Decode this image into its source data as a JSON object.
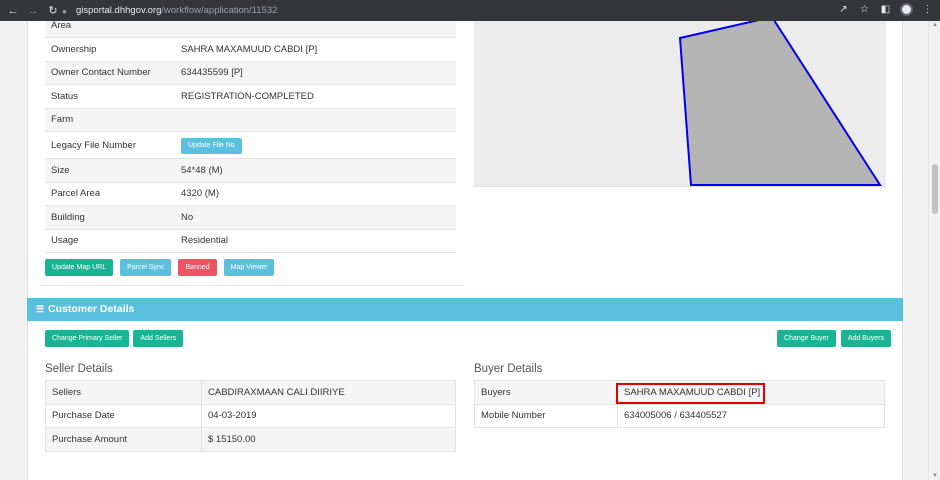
{
  "browser": {
    "url_host": "gisportal.dhhgov.org",
    "url_path": "/workflow/application/11532"
  },
  "parcel": {
    "partial_row_label": "Area",
    "rows": [
      {
        "label": "Ownership",
        "value": "SAHRA MAXAMUUD CABDI [P]"
      },
      {
        "label": "Owner Contact Number",
        "value": "634435599 [P]"
      },
      {
        "label": "Status",
        "value": "REGISTRATION-COMPLETED"
      },
      {
        "label": "Farm",
        "value": ""
      },
      {
        "label": "Legacy File Number",
        "value": ""
      },
      {
        "label": "Size",
        "value": "54*48 (M)"
      },
      {
        "label": "Parcel Area",
        "value": "4320 (M)"
      },
      {
        "label": "Building",
        "value": "No"
      },
      {
        "label": "Usage",
        "value": "Residential"
      }
    ],
    "update_file_button": "Update File No",
    "actions": {
      "update_map_url": "Update Map URL",
      "parcel_sync": "Parcel Sync",
      "banned": "Banned",
      "map_viewer": "Map Viewer"
    }
  },
  "customer": {
    "header": "Customer Details",
    "buttons": {
      "change_primary_seller": "Change Primary Seller",
      "add_sellers": "Add Sellers",
      "change_buyer": "Change Buyer",
      "add_buyers": "Add Buyers"
    },
    "seller_title": "Seller Details",
    "buyer_title": "Buyer Details",
    "sellers": [
      {
        "label": "Sellers",
        "value": "CABDIRAXMAAN CALI DIIRIYE"
      },
      {
        "label": "Purchase Date",
        "value": "04-03-2019"
      },
      {
        "label": "Purchase Amount",
        "value": "$ 15150.00"
      }
    ],
    "buyers": [
      {
        "label": "Buyers",
        "value": "SAHRA MAXAMUUD CABDI [P]"
      },
      {
        "label": "Mobile Number",
        "value": "634005006 / 634405527"
      }
    ]
  },
  "colors": {
    "primary_green": "#1ab394",
    "info_blue": "#5bc0de",
    "danger_red": "#ed5565",
    "highlight": "#e00000",
    "parcel_outline": "#0000ee",
    "parcel_fill": "#b5b5b5"
  }
}
